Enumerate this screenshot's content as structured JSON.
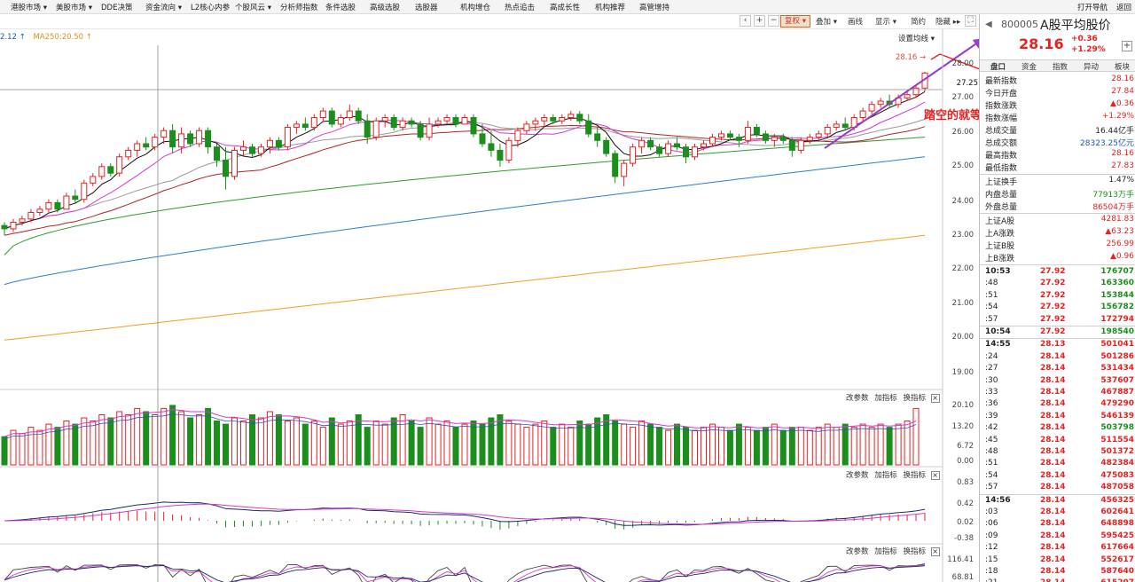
{
  "colors": {
    "up": "#e8201f",
    "down": "#1b8e1b",
    "ma5": "#111111",
    "ma10": "#d43ad0",
    "ma20": "#9a9a9a",
    "ma30": "#b02424",
    "ma60": "#2f9a2f",
    "ma120": "#2a7fd1",
    "ma250": "#f0a020",
    "annotation": "#9b3bc9"
  },
  "top_menu": {
    "items": [
      "港股市场 ▾",
      "美股市场 ▾",
      "DDE决策",
      "资金流向 ▾",
      "L2核心内参",
      "个股风云 ▾",
      "分析师指数",
      "条件选股",
      "高级选股",
      "选股器",
      "机构增仓",
      "热点追击",
      "高成长性",
      "机构推荐",
      "高管增持"
    ],
    "right_links": [
      "打开导航",
      "返回"
    ]
  },
  "toolbar": {
    "fuquan": "复权 ▾",
    "diejia": "叠加 ▾",
    "huaxian": "画线",
    "xianshi": "显示 ▾",
    "jianyue": "简约",
    "yincang": "隐藏 ▸▸"
  },
  "chart": {
    "ma_legend_a": "2.12 ↑",
    "ma_legend_b": "MA250:20.50 ↑",
    "setting_label": "设置均线 ▾",
    "current_price_tag": "28.16",
    "crosshair_value": "27.25",
    "annotation": "踏空的就等这个回踩",
    "price_axis": [
      "28.00",
      "27.00",
      "26.00",
      "25.00",
      "24.00",
      "23.00",
      "22.00",
      "21.00",
      "20.00",
      "19.00"
    ],
    "panel_controls": {
      "params": "改参数",
      "add": "加指标",
      "swap": "换指标",
      "close": "×"
    },
    "volume_axis": [
      "20.10",
      "13.20",
      "6.72",
      "0.00"
    ],
    "macd_axis": [
      "0.83",
      "0.42",
      "0.02",
      "-0.38"
    ],
    "kdj_axis": [
      "116.41",
      "68.81"
    ]
  },
  "chart_data": {
    "type": "candlestick",
    "title": "A股平均股价",
    "ma_visible_labels": {
      "MA250": 20.5
    },
    "y_range": [
      18.6,
      28.9
    ],
    "last_price": 28.16,
    "candles": [
      [
        23.5,
        23.6,
        23.2,
        23.4
      ],
      [
        23.4,
        23.7,
        23.3,
        23.6
      ],
      [
        23.6,
        23.8,
        23.5,
        23.7
      ],
      [
        23.7,
        24.0,
        23.6,
        23.9
      ],
      [
        23.9,
        24.1,
        23.8,
        24.0
      ],
      [
        24.0,
        24.3,
        23.9,
        24.2
      ],
      [
        24.2,
        24.3,
        23.9,
        24.0
      ],
      [
        24.0,
        24.5,
        24.0,
        24.4
      ],
      [
        24.4,
        24.6,
        24.2,
        24.3
      ],
      [
        24.3,
        24.9,
        24.2,
        24.8
      ],
      [
        24.8,
        25.1,
        24.7,
        25.0
      ],
      [
        25.0,
        25.4,
        24.9,
        25.3
      ],
      [
        25.3,
        25.4,
        25.0,
        25.1
      ],
      [
        25.1,
        25.7,
        25.0,
        25.6
      ],
      [
        25.6,
        25.9,
        25.5,
        25.8
      ],
      [
        25.8,
        26.1,
        25.6,
        26.0
      ],
      [
        26.0,
        26.2,
        25.8,
        25.9
      ],
      [
        25.9,
        26.3,
        25.8,
        26.2
      ],
      [
        26.2,
        26.5,
        26.0,
        26.4
      ],
      [
        26.4,
        26.6,
        25.7,
        25.9
      ],
      [
        25.9,
        26.5,
        25.7,
        26.3
      ],
      [
        26.3,
        26.4,
        25.9,
        26.0
      ],
      [
        26.0,
        26.5,
        25.9,
        26.4
      ],
      [
        26.4,
        26.5,
        25.7,
        25.9
      ],
      [
        25.9,
        26.0,
        25.3,
        25.5
      ],
      [
        25.5,
        25.9,
        24.6,
        25.0
      ],
      [
        25.0,
        25.9,
        24.9,
        25.8
      ],
      [
        25.8,
        26.1,
        25.6,
        25.9
      ],
      [
        25.9,
        26.0,
        25.6,
        25.7
      ],
      [
        25.7,
        26.0,
        25.6,
        25.9
      ],
      [
        25.9,
        26.2,
        25.7,
        26.1
      ],
      [
        26.1,
        26.2,
        25.8,
        25.9
      ],
      [
        25.9,
        26.6,
        25.8,
        26.5
      ],
      [
        26.5,
        26.7,
        26.3,
        26.6
      ],
      [
        26.6,
        26.8,
        26.4,
        26.5
      ],
      [
        26.5,
        26.9,
        26.4,
        26.8
      ],
      [
        26.8,
        27.1,
        26.7,
        27.0
      ],
      [
        27.0,
        27.1,
        26.5,
        26.6
      ],
      [
        26.6,
        26.9,
        26.5,
        26.8
      ],
      [
        26.8,
        27.2,
        26.7,
        27.0
      ],
      [
        27.0,
        27.1,
        26.6,
        26.7
      ],
      [
        26.7,
        26.9,
        26.0,
        26.2
      ],
      [
        26.2,
        26.8,
        26.1,
        26.7
      ],
      [
        26.7,
        26.9,
        26.5,
        26.8
      ],
      [
        26.8,
        26.9,
        26.4,
        26.5
      ],
      [
        26.5,
        26.8,
        26.4,
        26.7
      ],
      [
        26.7,
        26.8,
        26.5,
        26.6
      ],
      [
        26.6,
        26.7,
        26.1,
        26.2
      ],
      [
        26.2,
        26.8,
        26.1,
        26.6
      ],
      [
        26.6,
        26.8,
        26.5,
        26.7
      ],
      [
        26.7,
        26.9,
        26.6,
        26.8
      ],
      [
        26.8,
        26.9,
        26.5,
        26.6
      ],
      [
        26.6,
        26.9,
        26.6,
        26.8
      ],
      [
        26.8,
        26.9,
        26.2,
        26.3
      ],
      [
        26.3,
        26.6,
        25.9,
        26.0
      ],
      [
        26.0,
        26.4,
        25.6,
        25.8
      ],
      [
        25.8,
        26.0,
        25.3,
        25.5
      ],
      [
        25.5,
        26.2,
        25.4,
        26.1
      ],
      [
        26.1,
        26.5,
        25.9,
        26.4
      ],
      [
        26.4,
        26.7,
        26.3,
        26.6
      ],
      [
        26.6,
        26.8,
        26.4,
        26.7
      ],
      [
        26.7,
        26.9,
        26.5,
        26.8
      ],
      [
        26.8,
        26.9,
        26.6,
        26.7
      ],
      [
        26.7,
        26.9,
        26.6,
        26.8
      ],
      [
        26.8,
        27.0,
        26.7,
        26.9
      ],
      [
        26.9,
        27.0,
        26.6,
        26.7
      ],
      [
        26.7,
        26.9,
        26.2,
        26.3
      ],
      [
        26.3,
        26.5,
        25.9,
        26.1
      ],
      [
        26.1,
        26.2,
        25.6,
        25.7
      ],
      [
        25.7,
        25.8,
        24.8,
        25.0
      ],
      [
        25.0,
        25.5,
        24.7,
        25.4
      ],
      [
        25.4,
        26.0,
        25.3,
        25.9
      ],
      [
        25.9,
        26.2,
        25.7,
        26.1
      ],
      [
        26.1,
        26.2,
        25.8,
        25.9
      ],
      [
        25.9,
        26.0,
        25.6,
        25.7
      ],
      [
        25.7,
        26.1,
        25.6,
        26.0
      ],
      [
        26.0,
        26.2,
        25.8,
        25.9
      ],
      [
        25.9,
        26.0,
        25.4,
        25.6
      ],
      [
        25.6,
        26.0,
        25.5,
        25.9
      ],
      [
        25.9,
        26.1,
        25.8,
        26.0
      ],
      [
        26.0,
        26.3,
        25.9,
        26.2
      ],
      [
        26.2,
        26.4,
        26.1,
        26.3
      ],
      [
        26.3,
        26.4,
        26.1,
        26.2
      ],
      [
        26.2,
        26.3,
        25.9,
        26.1
      ],
      [
        26.1,
        26.7,
        26.0,
        26.5
      ],
      [
        26.5,
        26.6,
        26.2,
        26.3
      ],
      [
        26.3,
        26.4,
        26.0,
        26.1
      ],
      [
        26.1,
        26.3,
        25.9,
        26.2
      ],
      [
        26.2,
        26.3,
        26.0,
        26.1
      ],
      [
        26.1,
        26.2,
        25.6,
        25.8
      ],
      [
        25.8,
        26.2,
        25.7,
        26.1
      ],
      [
        26.1,
        26.3,
        26.0,
        26.2
      ],
      [
        26.2,
        26.4,
        26.1,
        26.3
      ],
      [
        26.3,
        26.6,
        26.2,
        26.5
      ],
      [
        26.5,
        26.7,
        26.4,
        26.6
      ],
      [
        26.6,
        26.8,
        26.4,
        26.5
      ],
      [
        26.5,
        26.9,
        26.4,
        26.8
      ],
      [
        26.8,
        27.1,
        26.7,
        27.0
      ],
      [
        27.0,
        27.3,
        26.9,
        27.2
      ],
      [
        27.2,
        27.4,
        27.1,
        27.3
      ],
      [
        27.3,
        27.5,
        27.1,
        27.2
      ],
      [
        27.2,
        27.5,
        27.1,
        27.4
      ],
      [
        27.4,
        27.6,
        27.3,
        27.5
      ],
      [
        27.5,
        27.8,
        27.4,
        27.7
      ],
      [
        27.7,
        28.2,
        27.6,
        28.16
      ]
    ],
    "volume": [
      9,
      11,
      10,
      12,
      11,
      13,
      12,
      14,
      13,
      15,
      14,
      16,
      15,
      17,
      16,
      18,
      17,
      16,
      18,
      19,
      17,
      15,
      16,
      18,
      14,
      13,
      15,
      14,
      16,
      15,
      17,
      16,
      14,
      15,
      13,
      14,
      12,
      15,
      13,
      14,
      16,
      12,
      14,
      13,
      15,
      16,
      14,
      12,
      15,
      13,
      14,
      12,
      13,
      14,
      13,
      15,
      16,
      14,
      13,
      12,
      13,
      14,
      12,
      13,
      12,
      14,
      13,
      15,
      16,
      14,
      13,
      12,
      14,
      13,
      12,
      11,
      13,
      12,
      11,
      12,
      13,
      12,
      11,
      13,
      12,
      11,
      12,
      13,
      11,
      12,
      12,
      11,
      12,
      13,
      12,
      13,
      12,
      13,
      12,
      13,
      12,
      13,
      14,
      18
    ],
    "volume_axis": [
      0.0,
      6.72,
      13.2,
      20.1
    ],
    "macd_axis": [
      -0.38,
      0.02,
      0.42,
      0.83
    ],
    "kdj_axis": [
      68.81,
      116.41
    ]
  },
  "right_panel": {
    "code": "800005",
    "name": "A股平均股价",
    "price": "28.16",
    "change": "+0.36",
    "change_pct": "+1.29%",
    "tabs": [
      "盘口",
      "资金",
      "指数",
      "异动",
      "板块"
    ],
    "stats": [
      {
        "label": "最新指数",
        "value": "28.16",
        "color": "red"
      },
      {
        "label": "今日开盘",
        "value": "27.84",
        "color": "red"
      },
      {
        "label": "指数涨跌",
        "value": "▲0.36",
        "color": "red"
      },
      {
        "label": "指数涨幅",
        "value": "+1.29%",
        "color": "red"
      },
      {
        "label": "总成交量",
        "value": "16.44亿手",
        "color": "dark"
      },
      {
        "label": "总成交额",
        "value": "28323.25亿元",
        "color": "blue"
      },
      {
        "label": "最高指数",
        "value": "28.16",
        "color": "red"
      },
      {
        "label": "最低指数",
        "value": "27.83",
        "color": "red"
      }
    ],
    "stats2": [
      {
        "label": "上证换手",
        "value": "1.47%",
        "color": "dark"
      },
      {
        "label": "内盘总量",
        "value": "77913万手",
        "color": "green"
      },
      {
        "label": "外盘总量",
        "value": "86504万手",
        "color": "red"
      }
    ],
    "stats3": [
      {
        "label": "上证A股",
        "value": "4281.83",
        "color": "red"
      },
      {
        "label": "上A涨跌",
        "value": "▲63.23",
        "color": "red"
      },
      {
        "label": "上证B股",
        "value": "256.99",
        "color": "red"
      },
      {
        "label": "上B涨跌",
        "value": "▲0.96",
        "color": "red"
      }
    ],
    "ticks": [
      {
        "time": "10:53",
        "price": "27.92",
        "vol": "176707",
        "color": "green",
        "bold_time": true
      },
      {
        "time": ":48",
        "price": "27.92",
        "vol": "163360",
        "color": "green"
      },
      {
        "time": ":51",
        "price": "27.92",
        "vol": "153844",
        "color": "green"
      },
      {
        "time": ":54",
        "price": "27.92",
        "vol": "156782",
        "color": "green"
      },
      {
        "time": ":57",
        "price": "27.92",
        "vol": "172794",
        "color": "red"
      },
      {
        "time": "10:54",
        "price": "27.92",
        "vol": "198540",
        "color": "green",
        "bold_time": true
      },
      {
        "time": "14:55",
        "price": "28.13",
        "vol": "501041",
        "color": "red",
        "bold_time": true
      },
      {
        "time": ":24",
        "price": "28.14",
        "vol": "501286",
        "color": "red"
      },
      {
        "time": ":27",
        "price": "28.14",
        "vol": "531434",
        "color": "red"
      },
      {
        "time": ":30",
        "price": "28.14",
        "vol": "537607",
        "color": "red"
      },
      {
        "time": ":33",
        "price": "28.14",
        "vol": "467887",
        "color": "red"
      },
      {
        "time": ":36",
        "price": "28.14",
        "vol": "479290",
        "color": "red"
      },
      {
        "time": ":39",
        "price": "28.14",
        "vol": "546139",
        "color": "red"
      },
      {
        "time": ":42",
        "price": "28.14",
        "vol": "503798",
        "color": "green"
      },
      {
        "time": ":45",
        "price": "28.14",
        "vol": "511554",
        "color": "red"
      },
      {
        "time": ":48",
        "price": "28.14",
        "vol": "501372",
        "color": "red"
      },
      {
        "time": ":51",
        "price": "28.14",
        "vol": "482384",
        "color": "red"
      },
      {
        "time": ":54",
        "price": "28.14",
        "vol": "475083",
        "color": "red"
      },
      {
        "time": ":57",
        "price": "28.14",
        "vol": "487058",
        "color": "red"
      },
      {
        "time": "14:56",
        "price": "28.14",
        "vol": "456325",
        "color": "red",
        "bold_time": true
      },
      {
        "time": ":03",
        "price": "28.14",
        "vol": "602641",
        "color": "red"
      },
      {
        "time": ":06",
        "price": "28.14",
        "vol": "648898",
        "color": "red"
      },
      {
        "time": ":09",
        "price": "28.14",
        "vol": "595425",
        "color": "red"
      },
      {
        "time": ":12",
        "price": "28.14",
        "vol": "617664",
        "color": "red"
      },
      {
        "time": ":15",
        "price": "28.14",
        "vol": "552617",
        "color": "red"
      },
      {
        "time": ":18",
        "price": "28.14",
        "vol": "587640",
        "color": "red"
      },
      {
        "time": ":21",
        "price": "28.14",
        "vol": "615207",
        "color": "red"
      }
    ]
  }
}
